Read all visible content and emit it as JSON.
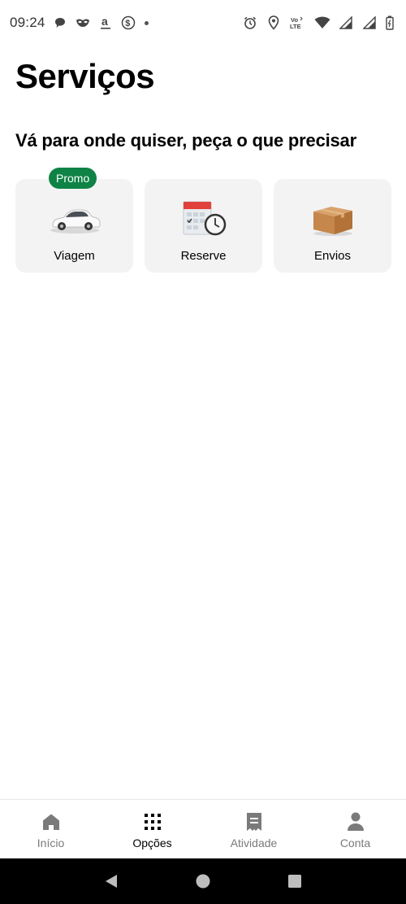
{
  "status_bar": {
    "time": "09:24",
    "left_icons": [
      "chat-bubble-icon",
      "mask-icon",
      "amazon-a-icon",
      "dollar-circle-icon",
      "dot-icon"
    ],
    "right_icons": [
      "alarm-icon",
      "location-pin-icon",
      "volte-icon",
      "wifi-icon",
      "signal-icon",
      "signal-icon",
      "battery-icon"
    ],
    "volte_text": "Vo LTE"
  },
  "header": {
    "title": "Serviços",
    "subtitle": "Vá para onde quiser, peça o que precisar"
  },
  "services": [
    {
      "label": "Viagem",
      "badge": "Promo",
      "icon": "car-icon"
    },
    {
      "label": "Reserve",
      "badge": "",
      "icon": "calendar-clock-icon"
    },
    {
      "label": "Envios",
      "badge": "",
      "icon": "package-box-icon"
    }
  ],
  "bottom_nav": {
    "items": [
      {
        "label": "Início",
        "icon": "home-icon",
        "active": false
      },
      {
        "label": "Opções",
        "icon": "grid-icon",
        "active": true
      },
      {
        "label": "Atividade",
        "icon": "receipt-icon",
        "active": false
      },
      {
        "label": "Conta",
        "icon": "person-icon",
        "active": false
      }
    ]
  },
  "colors": {
    "promo_badge": "#0e8345",
    "card_background": "#f3f3f3",
    "nav_inactive": "#7a7a7a",
    "nav_active": "#000000"
  }
}
